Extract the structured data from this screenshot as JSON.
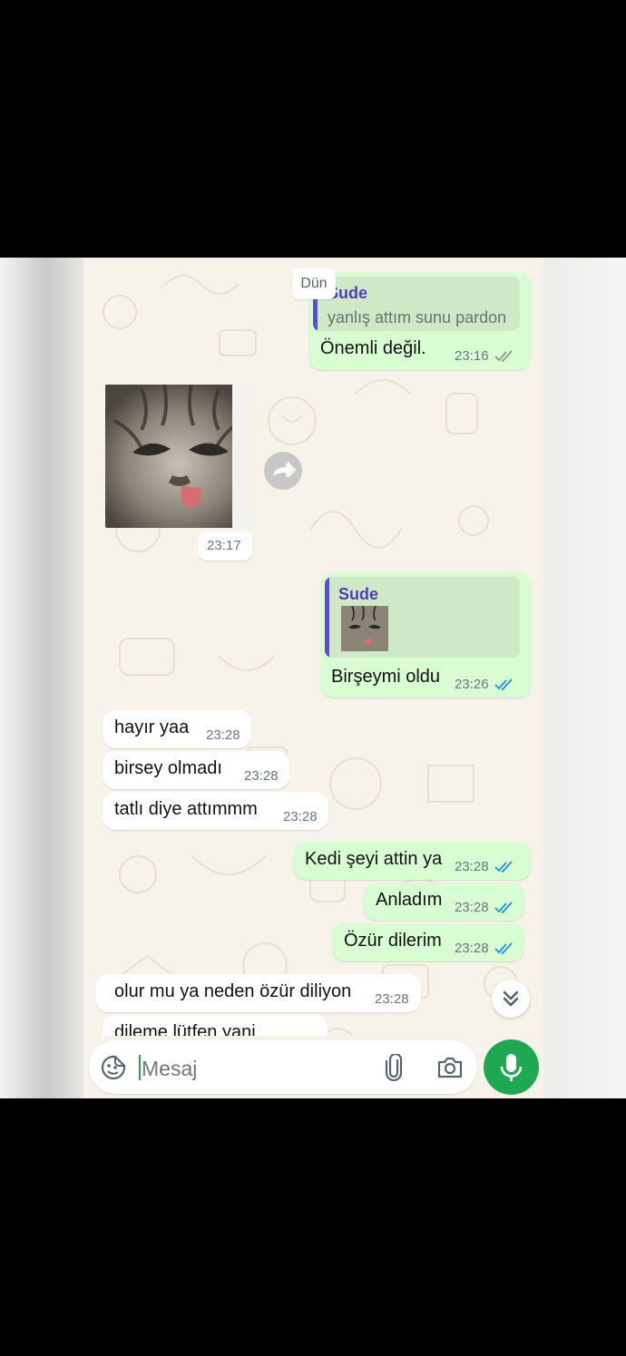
{
  "day_chip": "Dün",
  "messages": [
    {
      "id": "m1",
      "dir": "out",
      "reply": {
        "name": "Sude",
        "text": "yanlış attım sunu pardon"
      },
      "text": "Önemli değil.",
      "time": "23:16",
      "ticks": "read-gray"
    },
    {
      "id": "m2",
      "dir": "in",
      "type": "image",
      "image": "cat-sticker",
      "time": "23:17"
    },
    {
      "id": "m3",
      "dir": "out",
      "reply": {
        "name": "Sude",
        "image": "cat-thumbnail"
      },
      "text": "Birşeymi oldu",
      "time": "23:26",
      "ticks": "read-blue"
    },
    {
      "id": "m4",
      "dir": "in",
      "text": "hayır yaa",
      "time": "23:28"
    },
    {
      "id": "m5",
      "dir": "in",
      "text": "birsey olmadı",
      "time": "23:28"
    },
    {
      "id": "m6",
      "dir": "in",
      "text": "tatlı diye attımmm",
      "time": "23:28"
    },
    {
      "id": "m7",
      "dir": "out",
      "text": "Kedi şeyi attin ya",
      "time": "23:28",
      "ticks": "read-blue"
    },
    {
      "id": "m8",
      "dir": "out",
      "text": "Anladım",
      "time": "23:28",
      "ticks": "read-blue"
    },
    {
      "id": "m9",
      "dir": "out",
      "text": "Özür dilerim",
      "time": "23:28",
      "ticks": "read-blue"
    },
    {
      "id": "m10",
      "dir": "in",
      "text": "olur mu ya neden özür diliyon",
      "time": "23:28"
    },
    {
      "id": "m11",
      "dir": "in",
      "text": "dileme lütfen yani",
      "time": ""
    }
  ],
  "input": {
    "placeholder": "Mesaj"
  },
  "icons": {
    "emoji": "emoji-sticker-icon",
    "attach": "paperclip-icon",
    "camera": "camera-icon",
    "mic": "microphone-icon",
    "forward": "forward-icon",
    "scroll": "double-chevron-down-icon"
  },
  "colors": {
    "outgoing": "#d9fdd3",
    "incoming": "#ffffff",
    "accent": "#1da851",
    "quote_bar": "#5b4fd0",
    "read_tick": "#1f8fd6"
  }
}
